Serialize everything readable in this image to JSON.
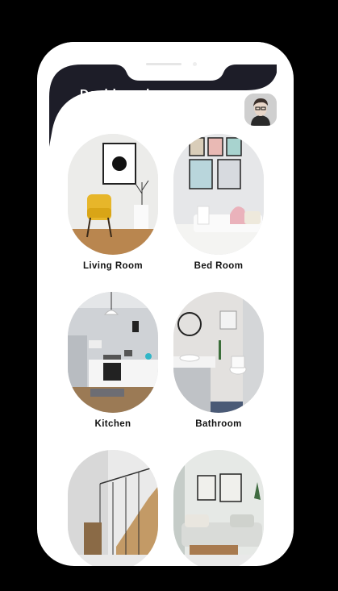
{
  "header": {
    "title": "Dashboard",
    "avatar": "user-avatar-icon"
  },
  "rooms": [
    {
      "label": "Living Room",
      "icon": "living-room-photo"
    },
    {
      "label": "Bed Room",
      "icon": "bed-room-photo"
    },
    {
      "label": "Kitchen",
      "icon": "kitchen-photo"
    },
    {
      "label": "Bathroom",
      "icon": "bathroom-photo"
    },
    {
      "label": "",
      "icon": "staircase-photo"
    },
    {
      "label": "",
      "icon": "lounge-photo"
    }
  ],
  "colors": {
    "header_bg": "#1d1d28",
    "page_bg": "#000000",
    "card_bg": "#ffffff"
  }
}
